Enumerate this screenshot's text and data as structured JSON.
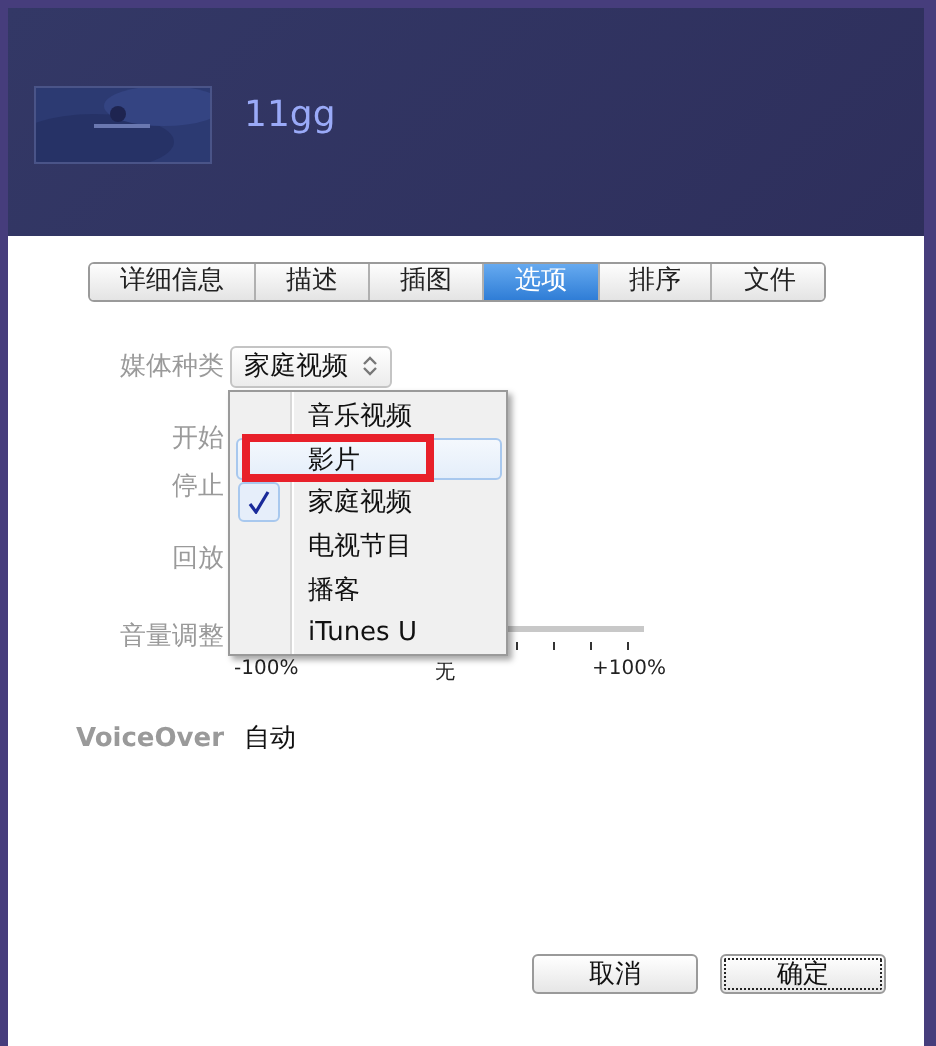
{
  "header": {
    "title": "11gg"
  },
  "tabs": [
    {
      "label": "详细信息",
      "selected": false
    },
    {
      "label": "描述",
      "selected": false
    },
    {
      "label": "插图",
      "selected": false
    },
    {
      "label": "选项",
      "selected": true
    },
    {
      "label": "排序",
      "selected": false
    },
    {
      "label": "文件",
      "selected": false
    }
  ],
  "form": {
    "media_kind": {
      "label": "媒体种类",
      "value": "家庭视频"
    },
    "rows": [
      {
        "label": "开始"
      },
      {
        "label": "停止"
      },
      {
        "label": "回放"
      }
    ],
    "volume": {
      "label": "音量调整",
      "ticks": [
        "-100%",
        "无",
        "+100%"
      ]
    },
    "voiceover": {
      "label": "VoiceOver",
      "value": "自动"
    }
  },
  "menu": {
    "items": [
      {
        "label": "音乐视频",
        "checked": false,
        "highlighted": false,
        "annotated": false
      },
      {
        "label": "影片",
        "checked": false,
        "highlighted": true,
        "annotated": true
      },
      {
        "label": "家庭视频",
        "checked": true,
        "highlighted": false,
        "annotated": false
      },
      {
        "label": "电视节目",
        "checked": false,
        "highlighted": false,
        "annotated": false
      },
      {
        "label": "播客",
        "checked": false,
        "highlighted": false,
        "annotated": false
      },
      {
        "label": "iTunes U",
        "checked": false,
        "highlighted": false,
        "annotated": false
      }
    ]
  },
  "buttons": [
    {
      "label": "取消",
      "focused": false
    },
    {
      "label": "确定",
      "focused": true
    }
  ]
}
